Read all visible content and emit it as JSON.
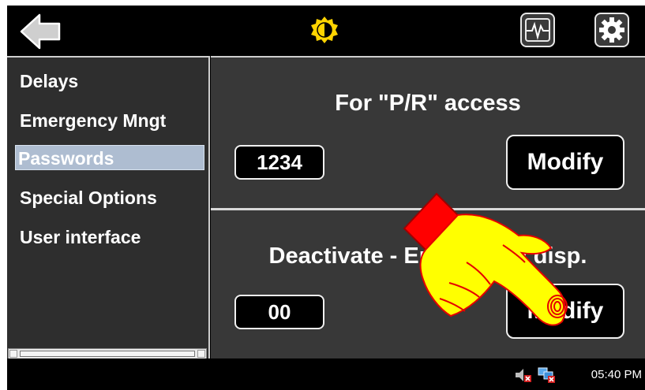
{
  "sidebar": {
    "items": [
      {
        "label": "Delays"
      },
      {
        "label": "Emergency Mngt"
      },
      {
        "label": "Passwords"
      },
      {
        "label": "Special Options"
      },
      {
        "label": "User interface"
      }
    ],
    "selected_index": 2
  },
  "sections": [
    {
      "title": "For \"P/R\" access",
      "value": "1234",
      "button_label": "Modify"
    },
    {
      "title": "Deactivate - Emergency disp.",
      "value": "00",
      "button_label": "Modify"
    }
  ],
  "topbar": {
    "back_icon": "back-arrow-icon",
    "brightness_icon": "brightness-icon",
    "monitor_icon": "waveform-monitor-icon",
    "settings_icon": "gear-icon"
  },
  "statusbar": {
    "time": "05:40 PM"
  },
  "colors": {
    "panel_bg": "#383838",
    "sidebar_bg": "#2e2e2e",
    "selected_bg": "#aebdd1",
    "hand_fill": "#ffff00",
    "hand_cuff": "#ff0000"
  }
}
